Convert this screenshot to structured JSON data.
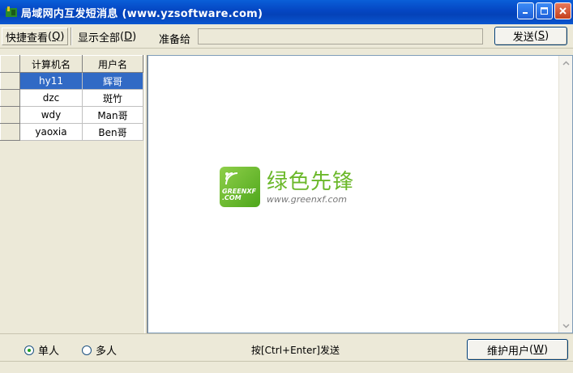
{
  "window": {
    "title": "局域网内互发短消息 (www.yzsoftware.com)"
  },
  "toolbar": {
    "quick_view_label": "快捷查看",
    "quick_view_key": "Q",
    "show_all_label": "显示全部",
    "show_all_key": "D",
    "ready_to_label": "准备给",
    "recipient_value": "",
    "send_label": "发送",
    "send_key": "S"
  },
  "user_table": {
    "headers": [
      "计算机名",
      "用户名"
    ],
    "rows": [
      {
        "computer": "hy11",
        "user": "辉哥",
        "selected": true
      },
      {
        "computer": "dzc",
        "user": "斑竹",
        "selected": false
      },
      {
        "computer": "wdy",
        "user": "Man哥",
        "selected": false
      },
      {
        "computer": "yaoxia",
        "user": "Ben哥",
        "selected": false
      }
    ]
  },
  "watermark": {
    "logo_text_1": "GREENXF",
    "logo_text_2": ".COM",
    "title": "绿色先锋",
    "url": "www.greenxf.com"
  },
  "bottom": {
    "single_label": "单人",
    "multi_label": "多人",
    "selected_mode": "single",
    "hint": "按[Ctrl+Enter]发送",
    "maintain_label": "维护用户",
    "maintain_key": "W"
  },
  "colors": {
    "title_bar": "#0548c4",
    "selection": "#316ac5",
    "watermark_green": "#6bb82a"
  }
}
